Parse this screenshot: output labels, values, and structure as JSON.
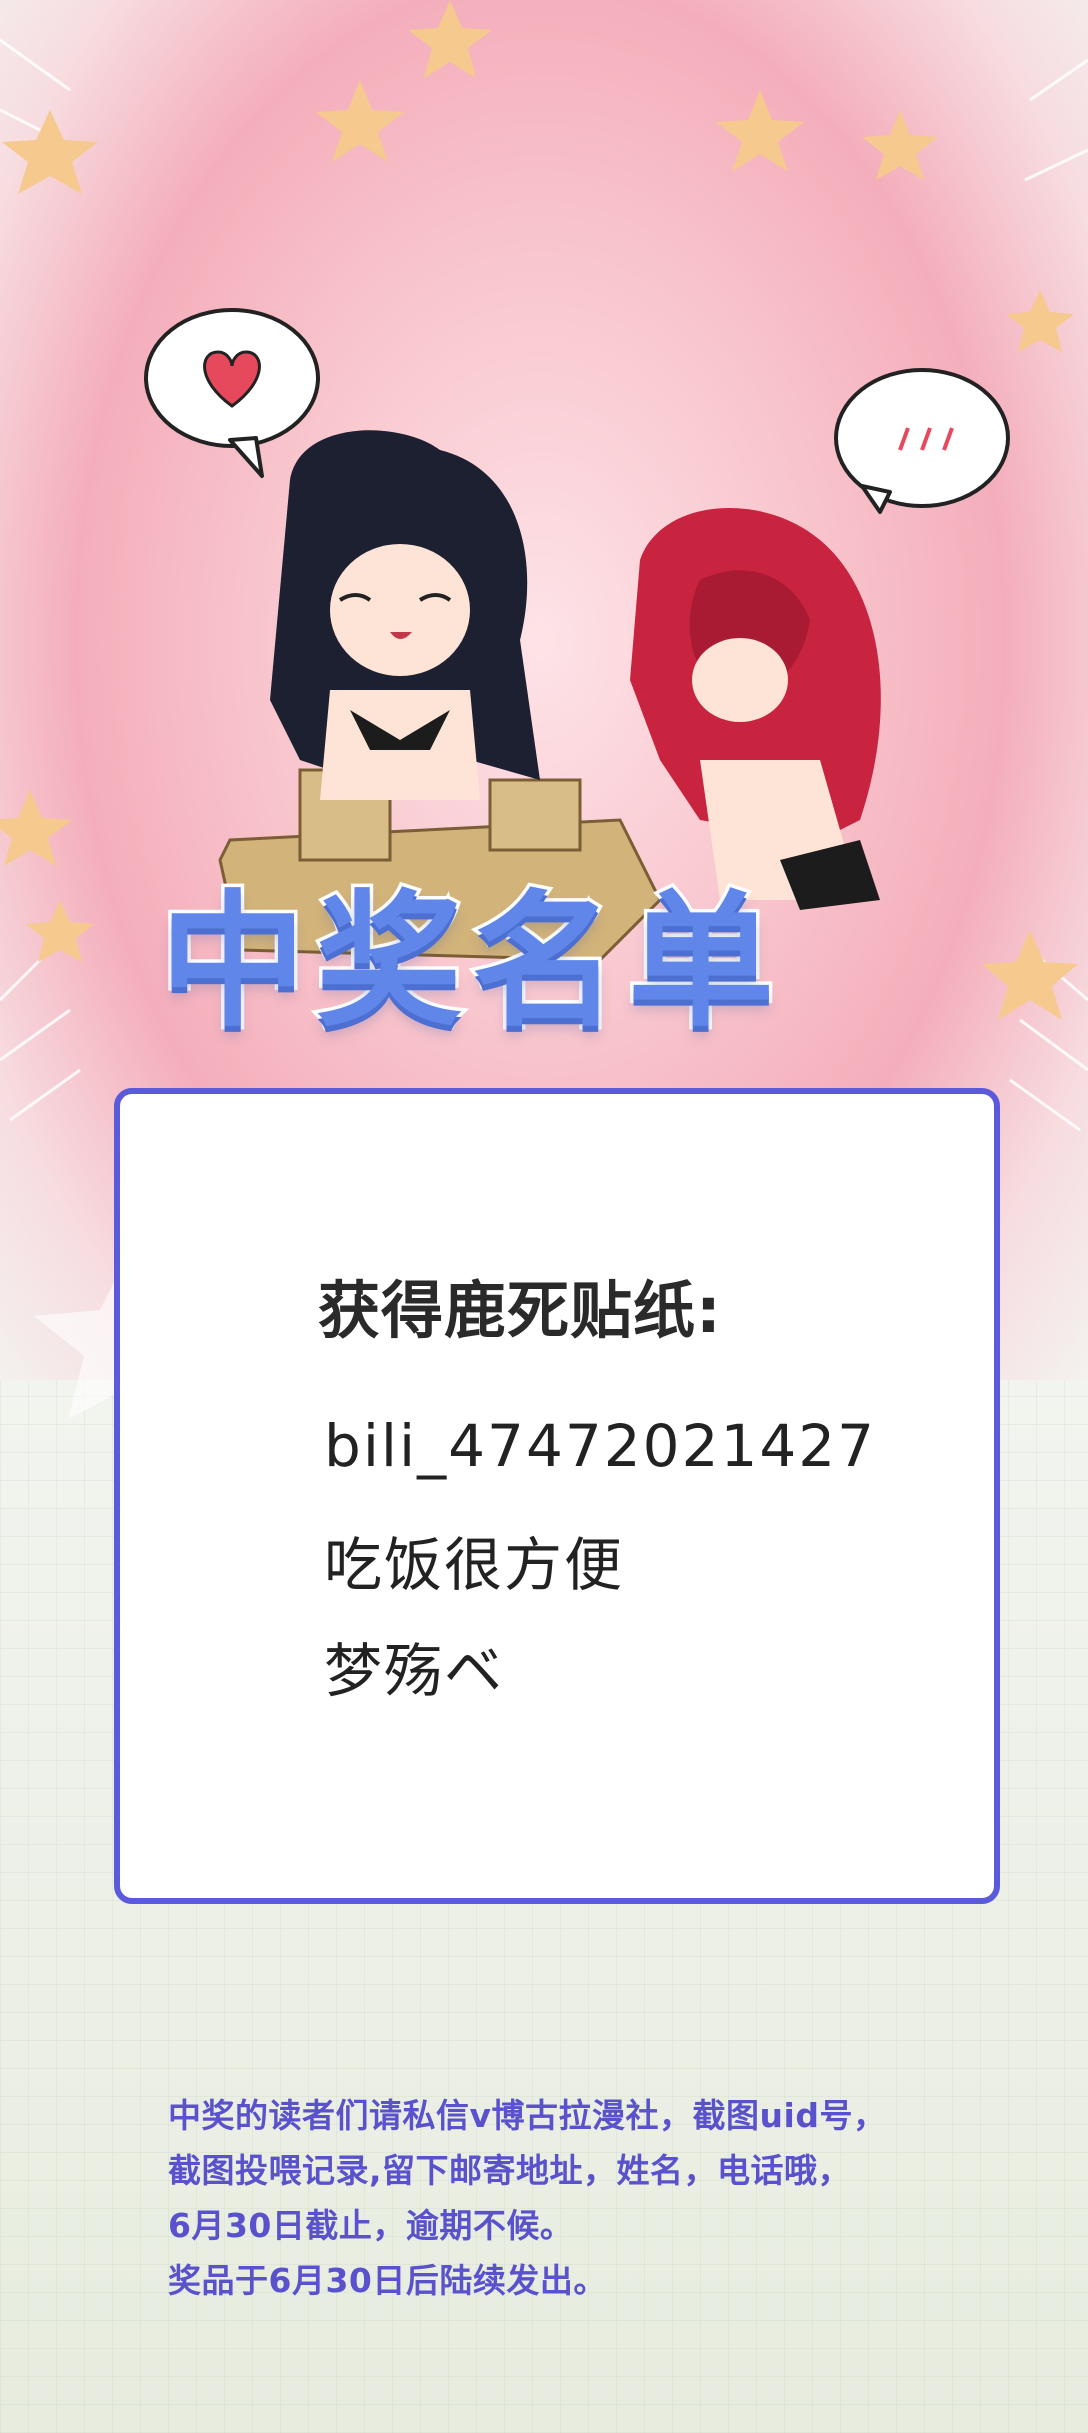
{
  "title": "中奖名单",
  "panel": {
    "heading": "获得鹿死贴纸:",
    "winners": [
      "bili_47472021427",
      "吃饭很方便",
      "梦殇ベ"
    ]
  },
  "notice": {
    "lines": [
      "中奖的读者们请私信v博古拉漫社，截图uid号，",
      "截图投喂记录,留下邮寄地址，姓名，电话哦，",
      "6月30日截止，逾期不候。",
      "奖品于6月30日后陆续发出。"
    ]
  },
  "colors": {
    "title_fill": "#5f86e8",
    "panel_border": "#5b59dc",
    "notice_text": "#5a52cc",
    "hero_pink": "#f4aebb",
    "star": "#f6c98f"
  },
  "icons": [
    "heart-icon",
    "speech-bubble",
    "star-decoration"
  ]
}
